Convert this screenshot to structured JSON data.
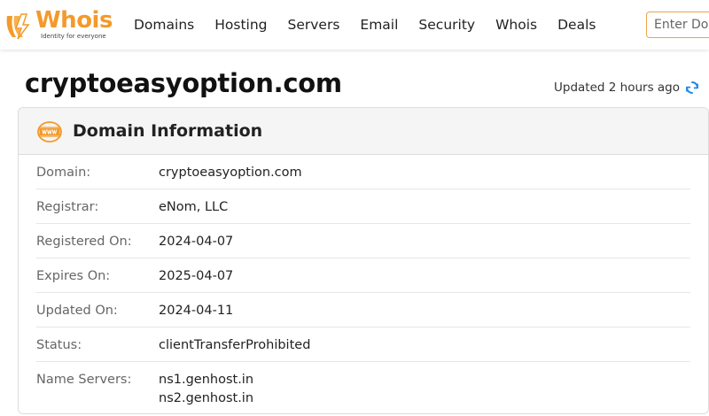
{
  "header": {
    "logo_word": "Whois",
    "logo_tagline": "Identity for everyone",
    "nav": [
      "Domains",
      "Hosting",
      "Servers",
      "Email",
      "Security",
      "Whois",
      "Deals"
    ],
    "search_placeholder": "Enter Domain"
  },
  "page": {
    "title": "cryptoeasyoption.com",
    "updated": "Updated 2 hours ago"
  },
  "card": {
    "title": "Domain Information",
    "rows": [
      {
        "label": "Domain:",
        "value": "cryptoeasyoption.com"
      },
      {
        "label": "Registrar:",
        "value": "eNom, LLC"
      },
      {
        "label": "Registered On:",
        "value": "2024-04-07"
      },
      {
        "label": "Expires On:",
        "value": "2025-04-07"
      },
      {
        "label": "Updated On:",
        "value": "2024-04-11"
      },
      {
        "label": "Status:",
        "value": "clientTransferProhibited"
      }
    ],
    "name_servers": {
      "label": "Name Servers:",
      "values": [
        "ns1.genhost.in",
        "ns2.genhost.in"
      ]
    }
  },
  "colors": {
    "brand": "#f39a2b",
    "accent_blue": "#1e88e5"
  },
  "icons": {
    "logo": "whois-logo-icon",
    "refresh": "refresh-icon",
    "card": "www-globe-icon"
  }
}
